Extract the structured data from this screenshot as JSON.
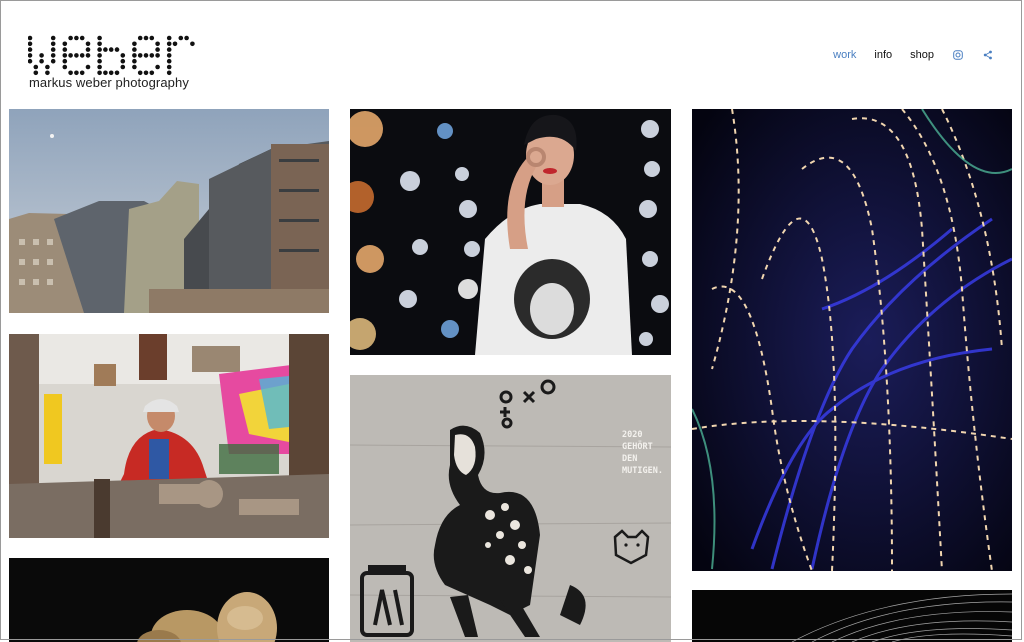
{
  "brand": {
    "tagline": "markus weber photography",
    "logo_text": "weber"
  },
  "nav": {
    "items": [
      {
        "label": "work",
        "active": true
      },
      {
        "label": "info",
        "active": false
      },
      {
        "label": "shop",
        "active": false
      }
    ],
    "icons": [
      "instagram-icon",
      "share-icon"
    ],
    "accent_color": "#4a7fc1"
  },
  "gallery": {
    "tiles": [
      {
        "subject": "architecture-buildings"
      },
      {
        "subject": "woman-portrait-bokeh"
      },
      {
        "subject": "light-painting-trails"
      },
      {
        "subject": "artist-workshop-portrait"
      },
      {
        "subject": "street-art-stencil"
      },
      {
        "subject": "still-life-dark"
      },
      {
        "subject": "star-trails-dark"
      }
    ],
    "street_art_text": [
      "2020",
      "GEHÖRT",
      "DEN",
      "MUTIGEN."
    ]
  }
}
